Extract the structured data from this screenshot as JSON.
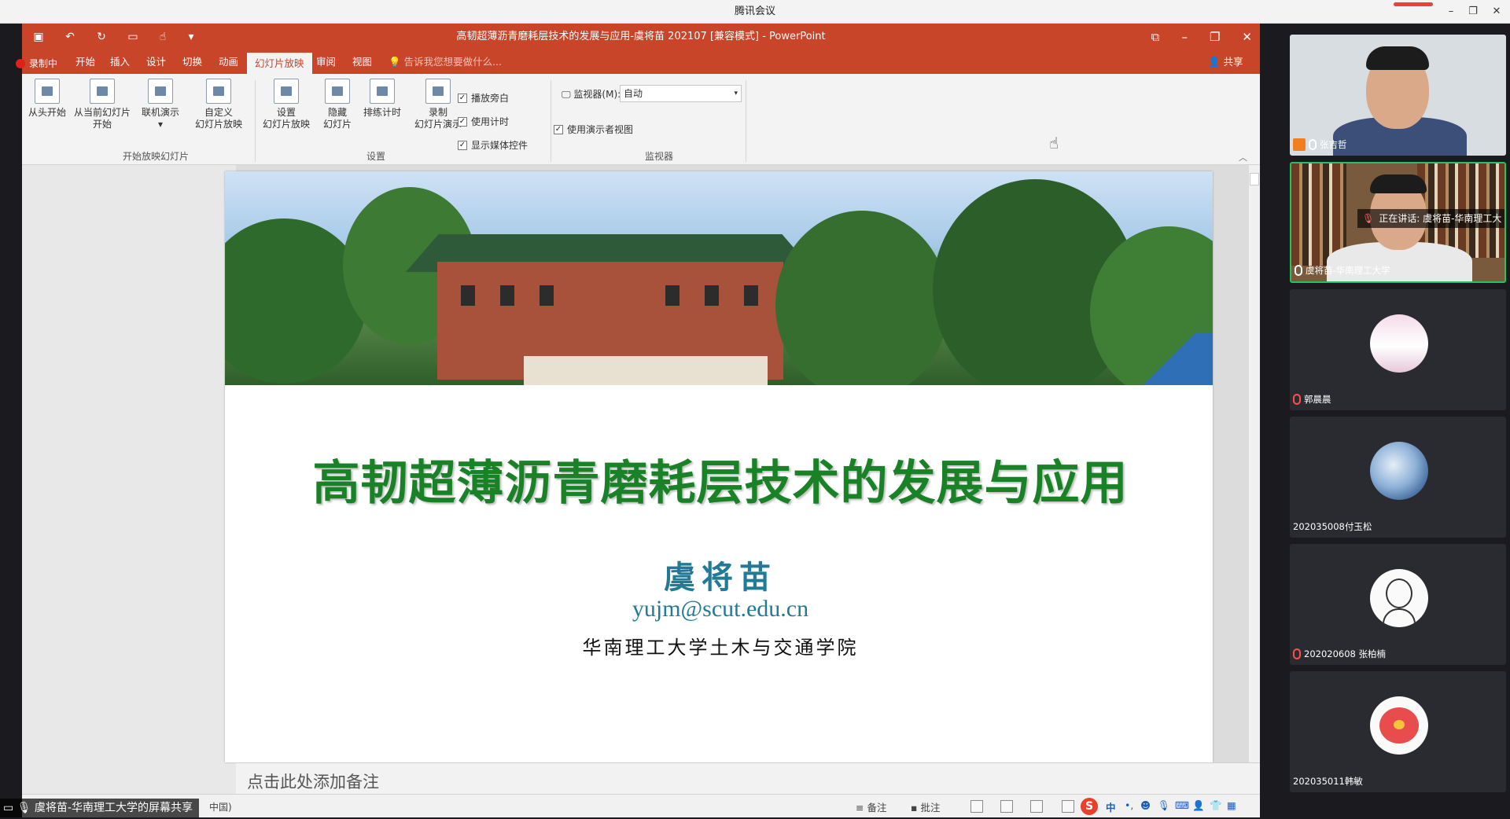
{
  "meeting": {
    "title": "腾讯会议",
    "share_label": "虞将苗-华南理工大学的屏幕共享"
  },
  "ppt": {
    "title": "高韧超薄沥青磨耗层技术的发展与应用-虞将苗 202107 [兼容模式] - PowerPoint",
    "recording": "录制中",
    "tabs": [
      "开始",
      "插入",
      "设计",
      "切换",
      "动画",
      "幻灯片放映",
      "审阅",
      "视图"
    ],
    "active_tab": "幻灯片放映",
    "tell_me": "告诉我您想要做什么...",
    "share": "共享",
    "ribbon": {
      "from_beginning": "从头开始",
      "from_current_1": "从当前幻灯片",
      "from_current_2": "开始",
      "online_present": "联机演示",
      "custom_1": "自定义",
      "custom_2": "幻灯片放映",
      "group_start": "开始放映幻灯片",
      "setup_1": "设置",
      "setup_2": "幻灯片放映",
      "hide_1": "隐藏",
      "hide_2": "幻灯片",
      "rehearse": "排练计时",
      "record_1": "录制",
      "record_2": "幻灯片演示",
      "group_setup": "设置",
      "chk_narration": "播放旁白",
      "chk_timing": "使用计时",
      "chk_media": "显示媒体控件",
      "monitor_label": "监视器(M):",
      "monitor_value": "自动",
      "presenter_view": "使用演示者视图",
      "group_monitor": "监视器"
    },
    "slide": {
      "title": "高韧超薄沥青磨耗层技术的发展与应用",
      "author": "虞将苗",
      "email": "yujm@scut.edu.cn",
      "institution": "华南理工大学土木与交通学院"
    },
    "notes_placeholder": "点击此处添加备注",
    "status": {
      "language": "中国)",
      "notes": "备注",
      "comments": "批注",
      "ime_cn": "中"
    }
  },
  "participants": [
    {
      "name": "张吉哲",
      "type": "video",
      "host": true,
      "mic": "on"
    },
    {
      "name": "虞将苗-华南理工大学",
      "type": "video",
      "speaking": true,
      "mic": "on",
      "speaking_label": "正在讲话: 虞将苗-华南理工大"
    },
    {
      "name": "郭晨晨",
      "type": "avatar",
      "mic": "off"
    },
    {
      "name": "202035008付玉松",
      "type": "avatar",
      "mic": "none"
    },
    {
      "name": "202020608 张柏楠",
      "type": "avatar",
      "mic": "off"
    },
    {
      "name": "202035011韩敏",
      "type": "avatar",
      "mic": "none"
    }
  ],
  "colors": {
    "ppt_accent": "#c8452a",
    "slide_title": "#198226",
    "slide_author": "#237a96",
    "speaking_border": "#23c45e"
  }
}
